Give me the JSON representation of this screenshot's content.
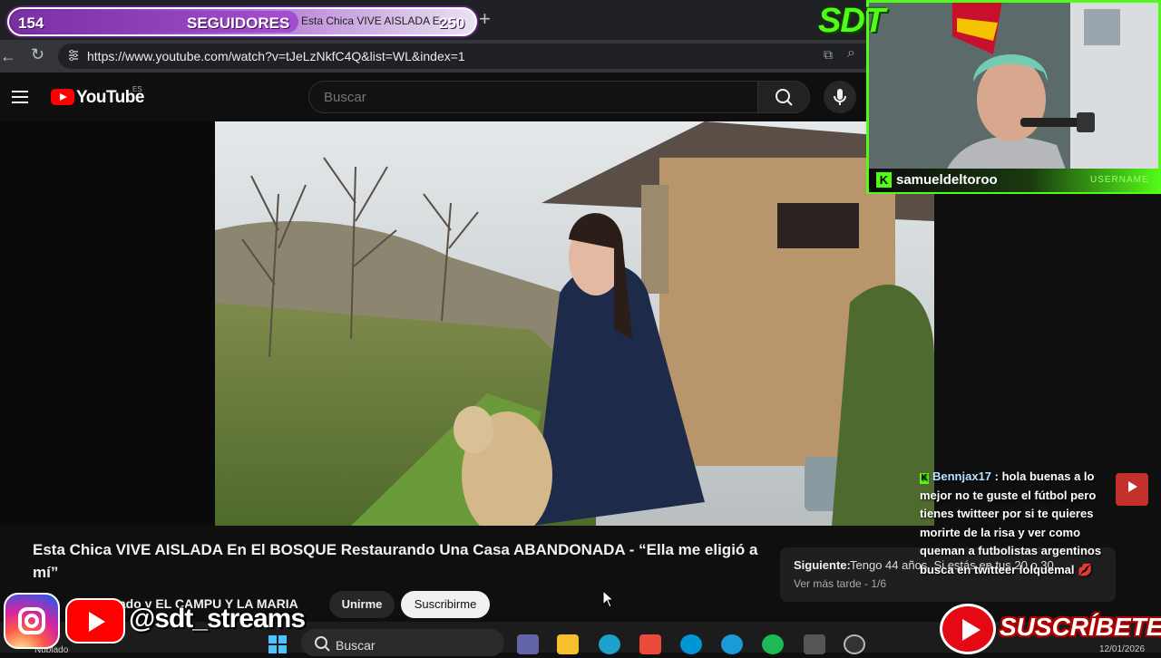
{
  "browser": {
    "tab_title": "Esta Chica VIVE AISLADA En",
    "url": "https://www.youtube.com/watch?v=tJeLzNkfC4Q&list=WL&index=1"
  },
  "follower_goal": {
    "current": "154",
    "label": "SEGUIDORES",
    "goal": "250",
    "progress": 0.616,
    "color": "#a44fd0"
  },
  "youtube": {
    "logo_text": "YouTube",
    "country": "ES",
    "search_placeholder": "Buscar"
  },
  "video": {
    "title": "Esta Chica VIVE AISLADA En El BOSQUE Restaurando Una Casa ABANDONADA - “Ella me eligió a mí”",
    "channel": "rrado y EL CAMPU Y LA MARIA",
    "join_label": "Unirme",
    "subscribe_label": "Suscribirme"
  },
  "playlist": {
    "next_label": "Siguiente:",
    "next_title": "Tengo 44 años. Si estás en tus 20 o 30...",
    "info": "Ver más tarde - 1/6"
  },
  "chat": {
    "user": "Bennjax17",
    "message": ": hola buenas a lo mejor no te guste el fútbol pero tienes twitteer por si te quieres morirte de la risa y ver como queman a futbolistas argentinos busca en twitteer lolquemal 💋"
  },
  "stream": {
    "logo": "SDT",
    "kick_username": "samueldeltoroo",
    "kick_label": "USERNAME",
    "accent": "#53fc18"
  },
  "socials": {
    "handle": "@sdt_streams",
    "subscribe": "SUSCRÍBETE"
  },
  "taskbar": {
    "search_label": "Buscar",
    "weather": "Nublado",
    "date": "12/01/2026"
  }
}
